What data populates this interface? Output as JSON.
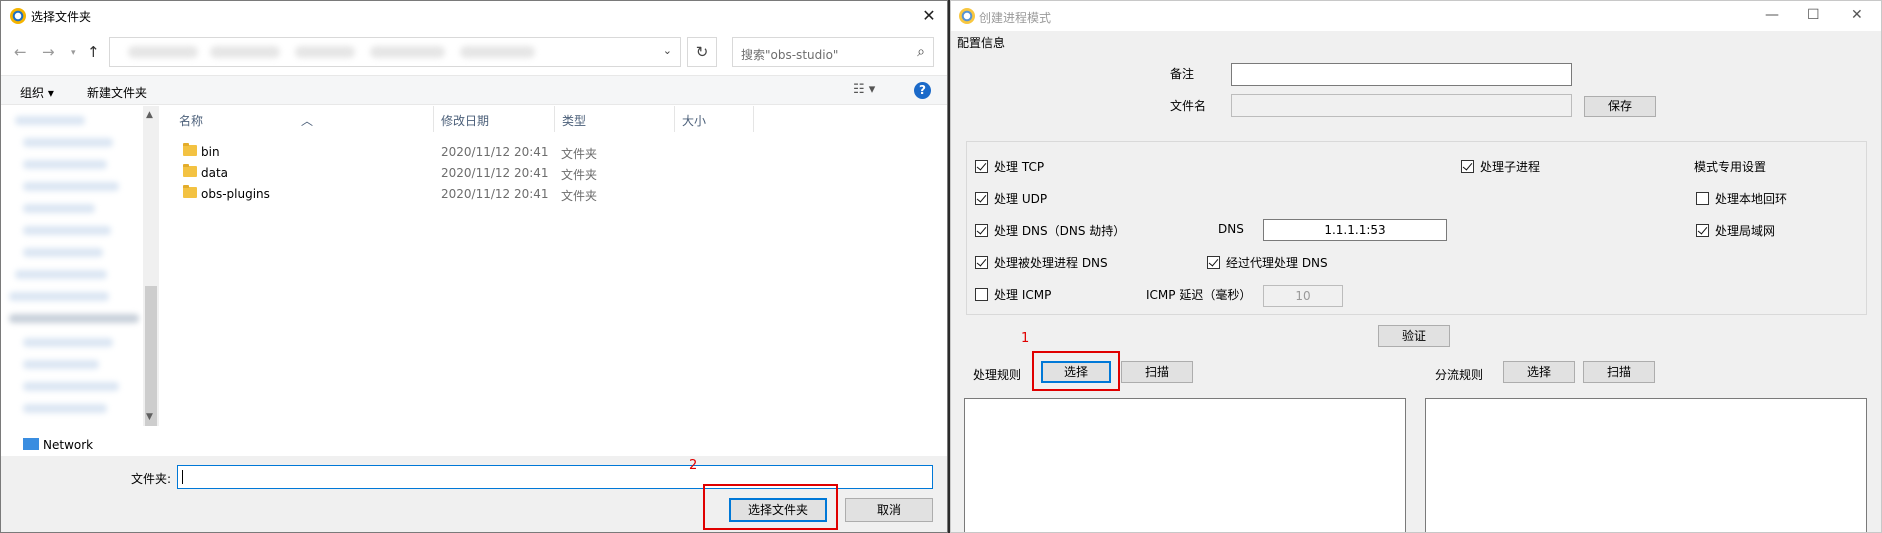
{
  "file_dialog": {
    "title": "选择文件夹",
    "search_placeholder": "搜索\"obs-studio\"",
    "toolbar": {
      "organize": "组织 ▾",
      "new_folder": "新建文件夹"
    },
    "columns": {
      "name": "名称",
      "date": "修改日期",
      "type": "类型",
      "size": "大小"
    },
    "files": [
      {
        "name": "bin",
        "date": "2020/11/12 20:41",
        "type": "文件夹"
      },
      {
        "name": "data",
        "date": "2020/11/12 20:41",
        "type": "文件夹"
      },
      {
        "name": "obs-plugins",
        "date": "2020/11/12 20:41",
        "type": "文件夹"
      }
    ],
    "nav_network": "Network",
    "folder_label": "文件夹:",
    "folder_value": "",
    "select_button": "选择文件夹",
    "cancel_button": "取消",
    "annotation_2": "2"
  },
  "app": {
    "title": "创建进程模式",
    "config_group": "配置信息",
    "note_label": "备注",
    "note_value": "",
    "filename_label": "文件名",
    "filename_value": "",
    "save_button": "保存",
    "options": {
      "tcp": "处理 TCP",
      "udp": "处理 UDP",
      "dns": "处理 DNS（DNS 劫持）",
      "dns_label": "DNS",
      "dns_value": "1.1.1.1:53",
      "handled_dns": "处理被处理进程 DNS",
      "proxy_dns": "经过代理处理 DNS",
      "icmp": "处理 ICMP",
      "icmp_delay_label": "ICMP 延迟（毫秒）",
      "icmp_delay_value": "10",
      "child": "处理子进程",
      "mode_settings": "模式专用设置",
      "loopback": "处理本地回环",
      "lan": "处理局域网"
    },
    "checked": {
      "tcp": true,
      "udp": true,
      "dns": true,
      "handled_dns": true,
      "proxy_dns": true,
      "icmp": false,
      "child": true,
      "loopback": false,
      "lan": true
    },
    "validate_button": "验证",
    "rules_label": "处理规则",
    "rules_select": "选择",
    "rules_scan": "扫描",
    "split_label": "分流规则",
    "split_select": "选择",
    "split_scan": "扫描",
    "annotation_1": "1"
  }
}
